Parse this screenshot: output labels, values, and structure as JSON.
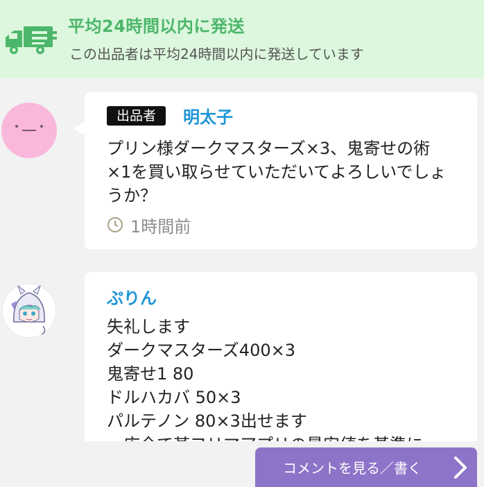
{
  "banner": {
    "title": "平均24時間以内に発送",
    "subtitle": "この出品者は平均24時間以内に発送しています",
    "icon": "truck-icon",
    "bg_color": "#dcf7dd",
    "accent_color": "#4cb66a"
  },
  "comments": [
    {
      "badge": "出品者",
      "author": "明太子",
      "text": "プリン様ダークマスターズ×3、鬼寄せの術×1を買い取らせていただいてよろしいでしょうか？",
      "time": "1時間前"
    },
    {
      "author": "ぷりん",
      "lines": [
        "失礼します",
        "ダークマスターズ400×3",
        "鬼寄せ1 80",
        "ドルハカバ 50×3",
        "パルテノン 80×3出せます",
        "一応全て某フリマアプリの最安値を基準に"
      ]
    }
  ],
  "footer": {
    "comment_button_label": "コメントを見る／書く",
    "button_color": "#8d74c8"
  },
  "colors": {
    "name_link": "#1e96d6",
    "background": "#f2f2f2"
  }
}
